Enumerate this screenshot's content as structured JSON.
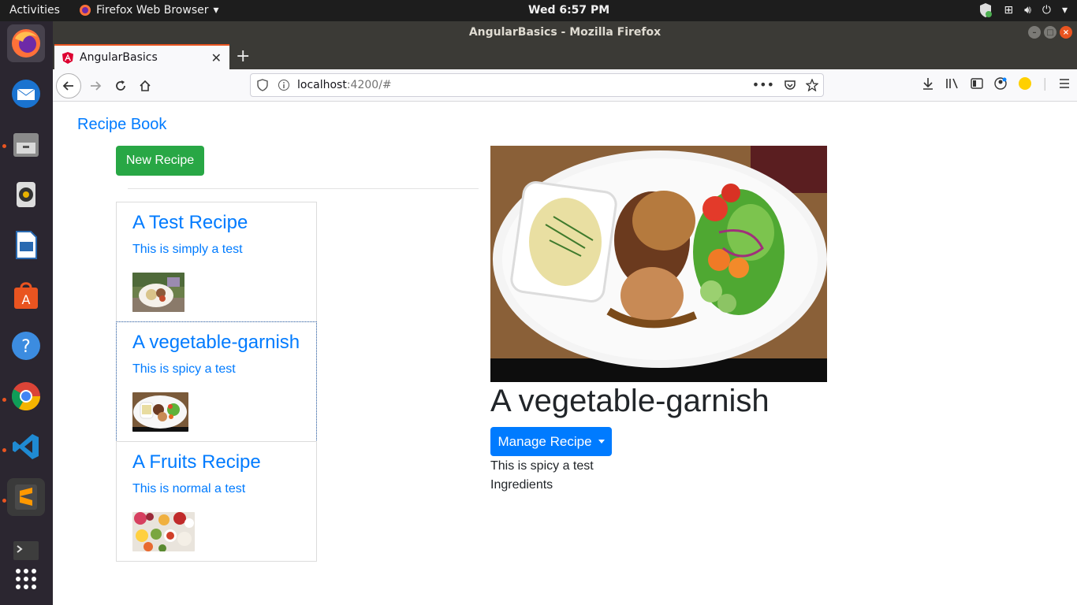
{
  "system": {
    "activities": "Activities",
    "app_menu": "Firefox Web Browser",
    "clock": "Wed  6:57 PM"
  },
  "window": {
    "title": "AngularBasics - Mozilla Firefox"
  },
  "browser": {
    "tab_title": "AngularBasics",
    "url_host": "localhost",
    "url_rest": ":4200/#"
  },
  "page": {
    "brand": "Recipe Book",
    "new_recipe_label": "New Recipe",
    "recipes": [
      {
        "name": "A Test Recipe",
        "description": "This is simply a test"
      },
      {
        "name": "A vegetable-garnish",
        "description": "This is spicy a test"
      },
      {
        "name": "A Fruits Recipe",
        "description": "This is normal a test"
      }
    ],
    "selected": {
      "name": "A vegetable-garnish",
      "manage_label": "Manage Recipe",
      "description": "This is spicy a test",
      "ingredients_label": "Ingredients"
    }
  },
  "colors": {
    "primary": "#007bff",
    "success": "#28a745",
    "ubuntu_orange": "#e95420"
  }
}
